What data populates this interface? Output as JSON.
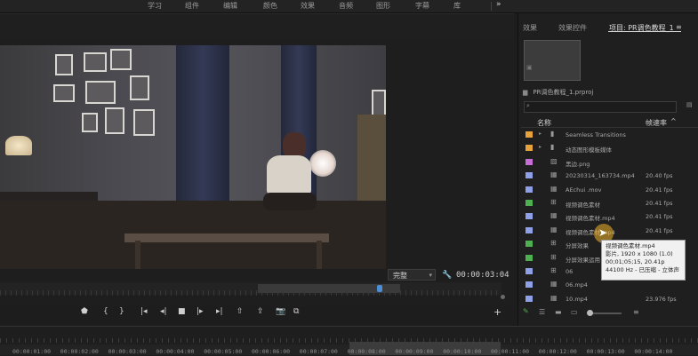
{
  "workspace_tabs": [
    "学习",
    "组件",
    "编辑",
    "颜色",
    "效果",
    "音频",
    "图形",
    "字幕",
    "库"
  ],
  "more_label": "»",
  "monitor": {
    "fit_label": "完整",
    "timecode": "00:00:03:04"
  },
  "panel": {
    "tabs": [
      "效果",
      "效果控件",
      "项目: PR调色教程_1"
    ],
    "menu_icon": "≡",
    "project_file": "PR调色教程_1.prproj",
    "columns": {
      "name": "名称",
      "rate": "帧速率"
    },
    "items": [
      {
        "name": "Seamless Transitions",
        "rate": "",
        "color": "#e8a23a",
        "type": "folder"
      },
      {
        "name": "动态图形模板媒体",
        "rate": "",
        "color": "#e8a23a",
        "type": "folder"
      },
      {
        "name": "黑边.png",
        "rate": "",
        "color": "#c56fd6",
        "type": "image"
      },
      {
        "name": "20230314_163734.mp4",
        "rate": "20.40 fps",
        "color": "#8fa0e6",
        "type": "clip"
      },
      {
        "name": "AEchui .mov",
        "rate": "20.41 fps",
        "color": "#8fa0e6",
        "type": "clip"
      },
      {
        "name": "视频调色素材",
        "rate": "20.41 fps",
        "color": "#4fb04f",
        "type": "sequence"
      },
      {
        "name": "视频调色素材.mp4",
        "rate": "20.41 fps",
        "color": "#8fa0e6",
        "type": "clip"
      },
      {
        "name": "视频调色素材.mp4",
        "rate": "20.41 fps",
        "color": "#8fa0e6",
        "type": "clip"
      },
      {
        "name": "分屏效果",
        "rate": "20.66 fps",
        "color": "#4fb04f",
        "type": "sequence"
      },
      {
        "name": "分屏效果运用",
        "rate": "",
        "color": "#4fb04f",
        "type": "sequence"
      },
      {
        "name": "06",
        "rate": "",
        "color": "#8fa0e6",
        "type": "sequence"
      },
      {
        "name": "06.mp4",
        "rate": "",
        "color": "#8fa0e6",
        "type": "clip"
      },
      {
        "name": "10.mp4",
        "rate": "23.976 fps",
        "color": "#8fa0e6",
        "type": "clip"
      }
    ],
    "tooltip": [
      "视频调色素材.mp4",
      "影片, 1920 x 1080 (1.0)",
      "00;01;05;15, 20.41p",
      "44100 Hz - 已压缩 - 立体声"
    ]
  },
  "timeline": {
    "ruler": [
      "00:00:01:00",
      "00:00:02:00",
      "00:00:03:00",
      "00:00:04:00",
      "00:00:05:00",
      "00:00:06:00",
      "00:00:07:00",
      "00:00:08:00",
      "00:00:09:00",
      "00:00:10:00",
      "00:00:11:00",
      "00:00:12:00",
      "00:00:13:00",
      "00:00:14:00"
    ]
  },
  "icons": {
    "wrench": "wrench-icon",
    "search": "search-icon",
    "new-bin": "new-bin-icon",
    "add": "add-icon"
  }
}
